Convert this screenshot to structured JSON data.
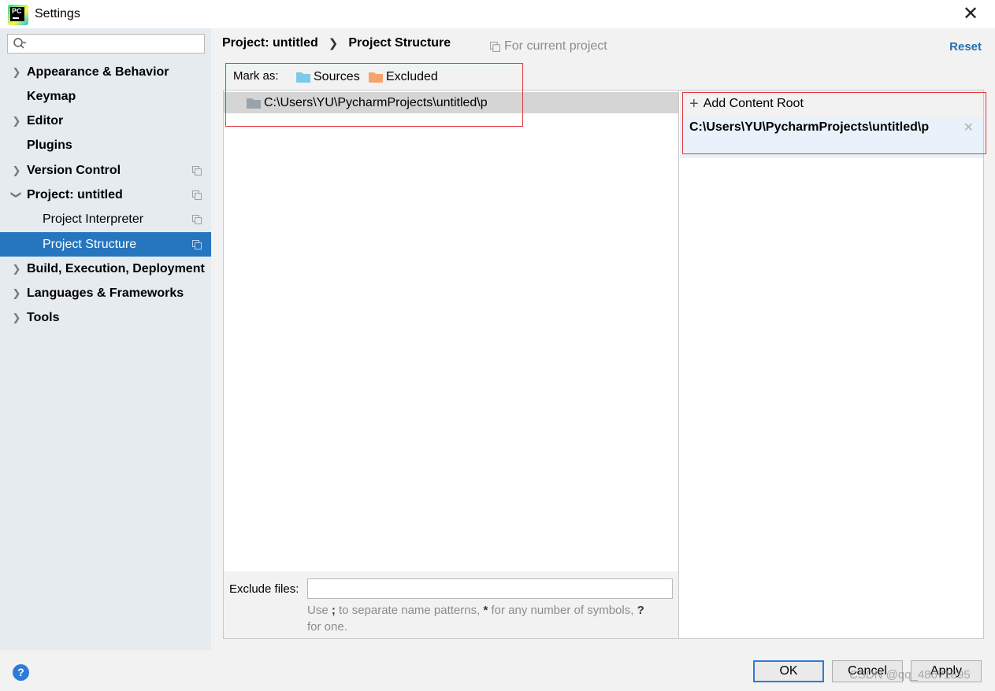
{
  "window": {
    "title": "Settings",
    "app_icon": "pycharm-logo",
    "app_icon_text": "PC"
  },
  "search": {
    "placeholder": "",
    "value": ""
  },
  "sidebar": {
    "items": [
      {
        "label": "Appearance & Behavior",
        "expandable": true,
        "bold": true
      },
      {
        "label": "Keymap",
        "expandable": false,
        "bold": true
      },
      {
        "label": "Editor",
        "expandable": true,
        "bold": true
      },
      {
        "label": "Plugins",
        "expandable": false,
        "bold": true
      },
      {
        "label": "Version Control",
        "expandable": true,
        "bold": true,
        "project_scoped": true
      },
      {
        "label": "Project: untitled",
        "expandable": true,
        "expanded": true,
        "bold": true,
        "project_scoped": true
      },
      {
        "label": "Project Interpreter",
        "child": true,
        "project_scoped": true
      },
      {
        "label": "Project Structure",
        "child": true,
        "selected": true,
        "project_scoped": true
      },
      {
        "label": "Build, Execution, Deployment",
        "expandable": true,
        "bold": true
      },
      {
        "label": "Languages & Frameworks",
        "expandable": true,
        "bold": true
      },
      {
        "label": "Tools",
        "expandable": true,
        "bold": true
      }
    ]
  },
  "header": {
    "breadcrumb": [
      "Project: untitled",
      "Project Structure"
    ],
    "scope_note": "For current project",
    "reset_label": "Reset"
  },
  "mark_as": {
    "label": "Mark as:",
    "buttons": [
      {
        "label": "Sources",
        "color": "#7ec8ea"
      },
      {
        "label": "Excluded",
        "color": "#f5a36c"
      }
    ]
  },
  "tree": {
    "root_path": "C:\\Users\\YU\\PycharmProjects\\untitled\\p"
  },
  "exclude": {
    "label": "Exclude files:",
    "value": "",
    "hint_prefix": "Use ",
    "hint_semicolon": ";",
    "hint_mid": " to separate name patterns, ",
    "hint_star": "*",
    "hint_mid2": " for any number of symbols, ",
    "hint_q": "?",
    "hint_end": " for one."
  },
  "content_roots": {
    "add_label": "Add Content Root",
    "roots": [
      "C:\\Users\\YU\\PycharmProjects\\untitled\\p"
    ]
  },
  "footer": {
    "help_label": "?",
    "ok_label": "OK",
    "cancel_label": "Cancel",
    "apply_label": "Apply",
    "watermark": "CSDN @qq_48671895"
  },
  "colors": {
    "selection": "#2675bf",
    "link": "#2470b3",
    "annotation_box": "#e0393e"
  }
}
